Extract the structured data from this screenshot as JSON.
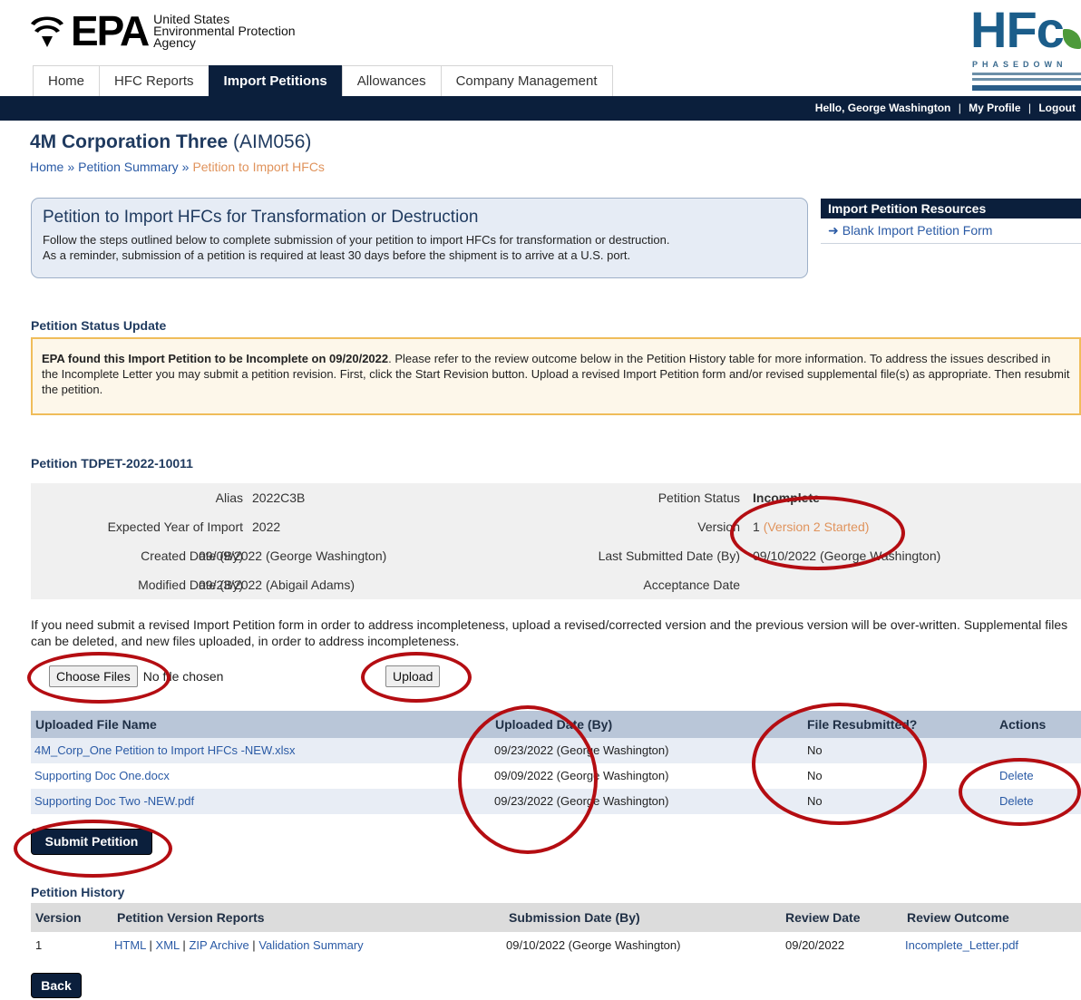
{
  "agency": {
    "logo_text": "EPA",
    "name_lines": [
      "United States",
      "Environmental Protection",
      "Agency"
    ]
  },
  "program_logo": {
    "word": "HFc",
    "subtitle": "PHASEDOWN"
  },
  "tabs": [
    {
      "label": "Home",
      "active": false
    },
    {
      "label": "HFC Reports",
      "active": false
    },
    {
      "label": "Import Petitions",
      "active": true
    },
    {
      "label": "Allowances",
      "active": false
    },
    {
      "label": "Company Management",
      "active": false
    }
  ],
  "user_bar": {
    "greeting": "Hello, George Washington",
    "profile": "My Profile",
    "logout": "Logout",
    "separator": "|"
  },
  "page": {
    "org_name": "4M Corporation Three",
    "org_code": "(AIM056)",
    "breadcrumb": [
      "Home",
      "Petition Summary",
      "Petition to Import HFCs"
    ],
    "breadcrumb_sep": "»"
  },
  "intro": {
    "title": "Petition to Import HFCs for Transformation or Destruction",
    "line1": "Follow the steps outlined below to complete submission of your petition to import HFCs for transformation or destruction.",
    "line2": "As a reminder, submission of a petition is required at least 30 days before the shipment is to arrive at a U.S. port."
  },
  "resources": {
    "heading": "Import Petition Resources",
    "link": "Blank Import Petition Form",
    "arrow": "➜"
  },
  "status_update": {
    "heading": "Petition Status Update",
    "bold": "EPA found this Import Petition to be Incomplete on 09/20/2022",
    "text": ". Please refer to the review outcome below in the Petition History table for more information. To address the issues described in the Incomplete Letter you may submit a petition revision. First, click the Start Revision button. Upload a revised Import Petition form and/or revised supplemental file(s) as appropriate. Then resubmit the petition."
  },
  "petition": {
    "heading": "Petition TDPET-2022-10011",
    "alias_label": "Alias",
    "alias": "2022C3B",
    "year_label": "Expected Year of Import",
    "year": "2022",
    "created_label": "Created Date (By)",
    "created": "09/09/2022 (George Washington)",
    "modified_label": "Modified Date (By)",
    "modified": "09/23/2022 (Abigail Adams)",
    "status_label": "Petition Status",
    "status": "Incomplete",
    "version_label": "Version",
    "version": "1",
    "version_note": "(Version 2 Started)",
    "last_submitted_label": "Last Submitted Date (By)",
    "last_submitted": "09/10/2022 (George Washington)",
    "acceptance_label": "Acceptance Date",
    "acceptance": ""
  },
  "upload": {
    "note": "If you need submit a revised Import Petition form in order to address incompleteness, upload a revised/corrected version and the previous version will be over-written. Supplemental files can be deleted, and new files uploaded, in order to address incompleteness.",
    "choose_label": "Choose Files",
    "no_file": "No file chosen",
    "upload_label": "Upload"
  },
  "files_table": {
    "headers": [
      "Uploaded File Name",
      "Uploaded Date (By)",
      "File Resubmitted?",
      "Actions"
    ],
    "rows": [
      {
        "name": "4M_Corp_One Petition to Import HFCs -NEW.xlsx",
        "date": "09/23/2022 (George Washington)",
        "resubmitted": "No",
        "action": ""
      },
      {
        "name": "Supporting Doc One.docx",
        "date": "09/09/2022 (George Washington)",
        "resubmitted": "No",
        "action": "Delete"
      },
      {
        "name": "Supporting Doc Two -NEW.pdf",
        "date": "09/23/2022 (George Washington)",
        "resubmitted": "No",
        "action": "Delete"
      }
    ]
  },
  "submit_label": "Submit Petition",
  "history": {
    "heading": "Petition History",
    "headers": [
      "Version",
      "Petition Version Reports",
      "Submission Date (By)",
      "Review Date",
      "Review Outcome"
    ],
    "rows": [
      {
        "version": "1",
        "reports": [
          "HTML",
          "XML",
          "ZIP Archive",
          "Validation Summary"
        ],
        "submitted": "09/10/2022 (George Washington)",
        "review_date": "09/20/2022",
        "outcome": "Incomplete_Letter.pdf"
      }
    ],
    "report_sep": "|"
  },
  "back_label": "Back",
  "colors": {
    "navy": "#0b1f3c",
    "link": "#2a5aa5",
    "breadcrumb_current": "#e0935c",
    "annotation": "#b40d12"
  }
}
